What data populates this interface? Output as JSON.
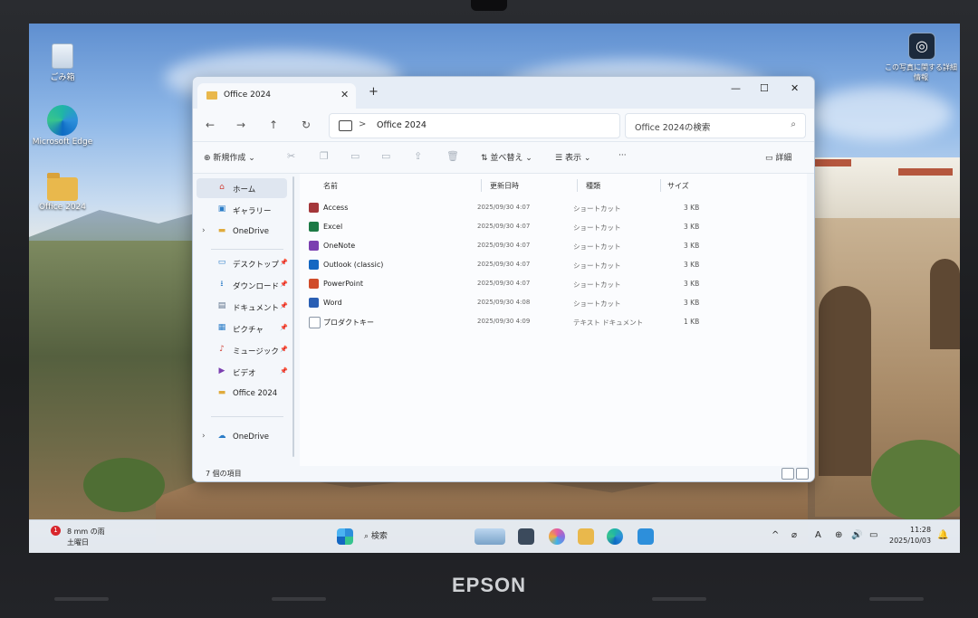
{
  "device": {
    "brand": "EPSON"
  },
  "desktop": {
    "icons": [
      {
        "label": "ごみ箱"
      },
      {
        "label": "Microsoft Edge"
      },
      {
        "label": "Office 2024"
      }
    ],
    "spotlight_label": "この写真に関する詳細情報"
  },
  "window": {
    "tab_title": "Office 2024",
    "new_tab": "+",
    "controls": {
      "minimize": "—",
      "maximize": "☐",
      "close": "✕"
    },
    "nav": {
      "back": "←",
      "forward": "→",
      "up": "↑",
      "refresh": "↻"
    },
    "address": {
      "separator": ">",
      "path": "Office 2024"
    },
    "search": {
      "placeholder": "Office 2024の検索",
      "icon": "⌕"
    },
    "toolbar": {
      "new_label": "新規作成",
      "sort_label": "並べ替え",
      "view_label": "表示",
      "more_label": "···",
      "details_label": "詳細"
    },
    "sidebar": [
      {
        "label": "ホーム",
        "icon": "⌂",
        "selected": true
      },
      {
        "label": "ギャラリー",
        "icon": "▣"
      },
      {
        "label": "OneDrive",
        "icon": "▬",
        "expandable": true
      },
      {
        "label": "デスクトップ",
        "icon": "▭",
        "pinned": true
      },
      {
        "label": "ダウンロード",
        "icon": "⭳",
        "pinned": true
      },
      {
        "label": "ドキュメント",
        "icon": "▤",
        "pinned": true
      },
      {
        "label": "ピクチャ",
        "icon": "▦",
        "pinned": true
      },
      {
        "label": "ミュージック",
        "icon": "♪",
        "pinned": true
      },
      {
        "label": "ビデオ",
        "icon": "▶",
        "pinned": true
      },
      {
        "label": "Office 2024",
        "icon": "▬"
      },
      {
        "label": "OneDrive",
        "icon": "☁",
        "expandable": true
      }
    ],
    "columns": {
      "name": "名前",
      "modified": "更新日時",
      "type": "種類",
      "size": "サイズ"
    },
    "files": [
      {
        "name": "Access",
        "modified": "2025/09/30 4:07",
        "type": "ショートカット",
        "size": "3 KB",
        "color": "#a4373a"
      },
      {
        "name": "Excel",
        "modified": "2025/09/30 4:07",
        "type": "ショートカット",
        "size": "3 KB",
        "color": "#1d7a45"
      },
      {
        "name": "OneNote",
        "modified": "2025/09/30 4:07",
        "type": "ショートカット",
        "size": "3 KB",
        "color": "#7b3fb0"
      },
      {
        "name": "Outlook (classic)",
        "modified": "2025/09/30 4:07",
        "type": "ショートカット",
        "size": "3 KB",
        "color": "#1467c2"
      },
      {
        "name": "PowerPoint",
        "modified": "2025/09/30 4:07",
        "type": "ショートカット",
        "size": "3 KB",
        "color": "#d04c2a"
      },
      {
        "name": "Word",
        "modified": "2025/09/30 4:08",
        "type": "ショートカット",
        "size": "3 KB",
        "color": "#2a5fb4"
      },
      {
        "name": "プロダクトキー",
        "modified": "2025/09/30 4:09",
        "type": "テキスト ドキュメント",
        "size": "1 KB",
        "color": "#8a96a6"
      }
    ],
    "status": "7 個の項目"
  },
  "taskbar": {
    "weather_badge": "1",
    "weather_line1": "8 mm の雨",
    "weather_line2": "土曜日",
    "search_label": "検索",
    "tray_chevron": "^",
    "ime": "A",
    "time": "11:28",
    "date": "2025/10/03"
  }
}
